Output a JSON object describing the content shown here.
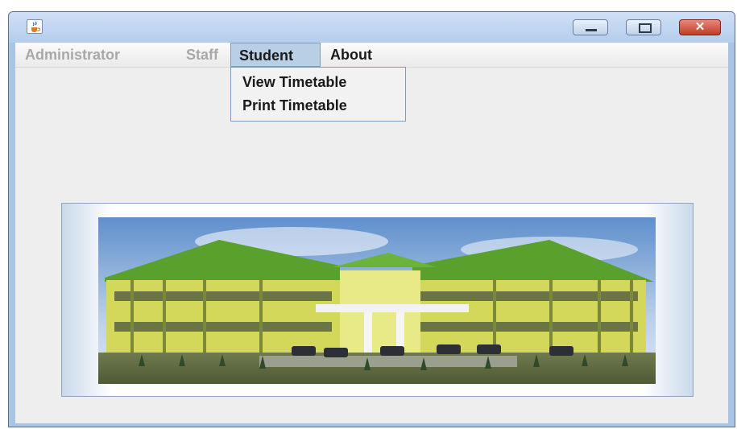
{
  "window": {
    "icon": "java-cup-icon",
    "controls": {
      "minimize": "minimize-icon",
      "maximize": "maximize-icon",
      "close": "✕"
    }
  },
  "menubar": {
    "items": [
      {
        "label": "Administrator",
        "enabled": false
      },
      {
        "label": "Staff",
        "enabled": false
      },
      {
        "label": "Student",
        "enabled": true,
        "open": true
      },
      {
        "label": "About",
        "enabled": true
      }
    ]
  },
  "dropdown": {
    "items": [
      {
        "label": "View Timetable"
      },
      {
        "label": "Print Timetable"
      }
    ]
  },
  "colors": {
    "menu_active_bg": "#b8cfe5",
    "disabled_text": "#a8a8a8",
    "roof_green": "#5aa02c",
    "wall_yellow": "#d8dc5a"
  }
}
